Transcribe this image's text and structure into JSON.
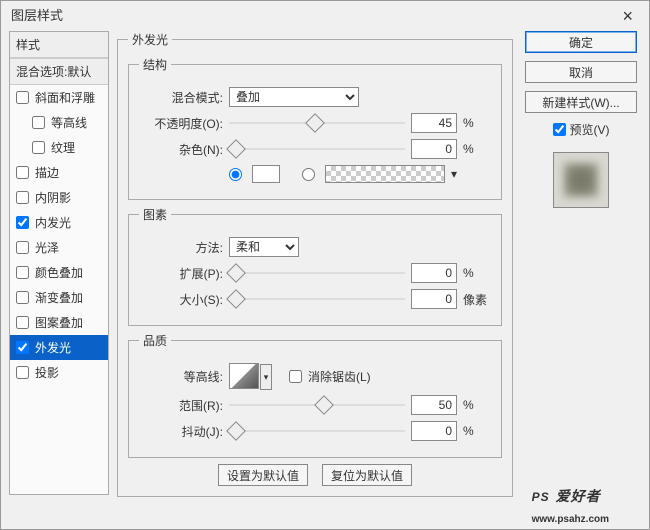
{
  "window": {
    "title": "图层样式",
    "close": "×"
  },
  "sidebar": {
    "header": "样式",
    "subheader": "混合选项:默认",
    "items": [
      {
        "label": "斜面和浮雕",
        "checked": false,
        "indent": false
      },
      {
        "label": "等高线",
        "checked": false,
        "indent": true
      },
      {
        "label": "纹理",
        "checked": false,
        "indent": true
      },
      {
        "label": "描边",
        "checked": false,
        "indent": false
      },
      {
        "label": "内阴影",
        "checked": false,
        "indent": false
      },
      {
        "label": "内发光",
        "checked": true,
        "indent": false
      },
      {
        "label": "光泽",
        "checked": false,
        "indent": false
      },
      {
        "label": "颜色叠加",
        "checked": false,
        "indent": false
      },
      {
        "label": "渐变叠加",
        "checked": false,
        "indent": false
      },
      {
        "label": "图案叠加",
        "checked": false,
        "indent": false
      },
      {
        "label": "外发光",
        "checked": true,
        "indent": false,
        "selected": true
      },
      {
        "label": "投影",
        "checked": false,
        "indent": false
      }
    ]
  },
  "panel": {
    "title": "外发光",
    "structure": {
      "legend": "结构",
      "blend_label": "混合模式:",
      "blend_value": "叠加",
      "opacity_label": "不透明度(O):",
      "opacity_value": "45",
      "opacity_unit": "%",
      "noise_label": "杂色(N):",
      "noise_value": "0",
      "noise_unit": "%"
    },
    "elements": {
      "legend": "图素",
      "technique_label": "方法:",
      "technique_value": "柔和",
      "spread_label": "扩展(P):",
      "spread_value": "0",
      "spread_unit": "%",
      "size_label": "大小(S):",
      "size_value": "0",
      "size_unit": "像素"
    },
    "quality": {
      "legend": "品质",
      "contour_label": "等高线:",
      "anti_label": "消除锯齿(L)",
      "range_label": "范围(R):",
      "range_value": "50",
      "range_unit": "%",
      "jitter_label": "抖动(J):",
      "jitter_value": "0",
      "jitter_unit": "%"
    },
    "buttons": {
      "set_default": "设置为默认值",
      "reset_default": "复位为默认值"
    }
  },
  "right": {
    "ok": "确定",
    "cancel": "取消",
    "new_style": "新建样式(W)...",
    "preview_label": "预览(V)"
  },
  "watermark": {
    "brand": "PS",
    "sub": "爱好者",
    "url": "www.psahz.com"
  }
}
